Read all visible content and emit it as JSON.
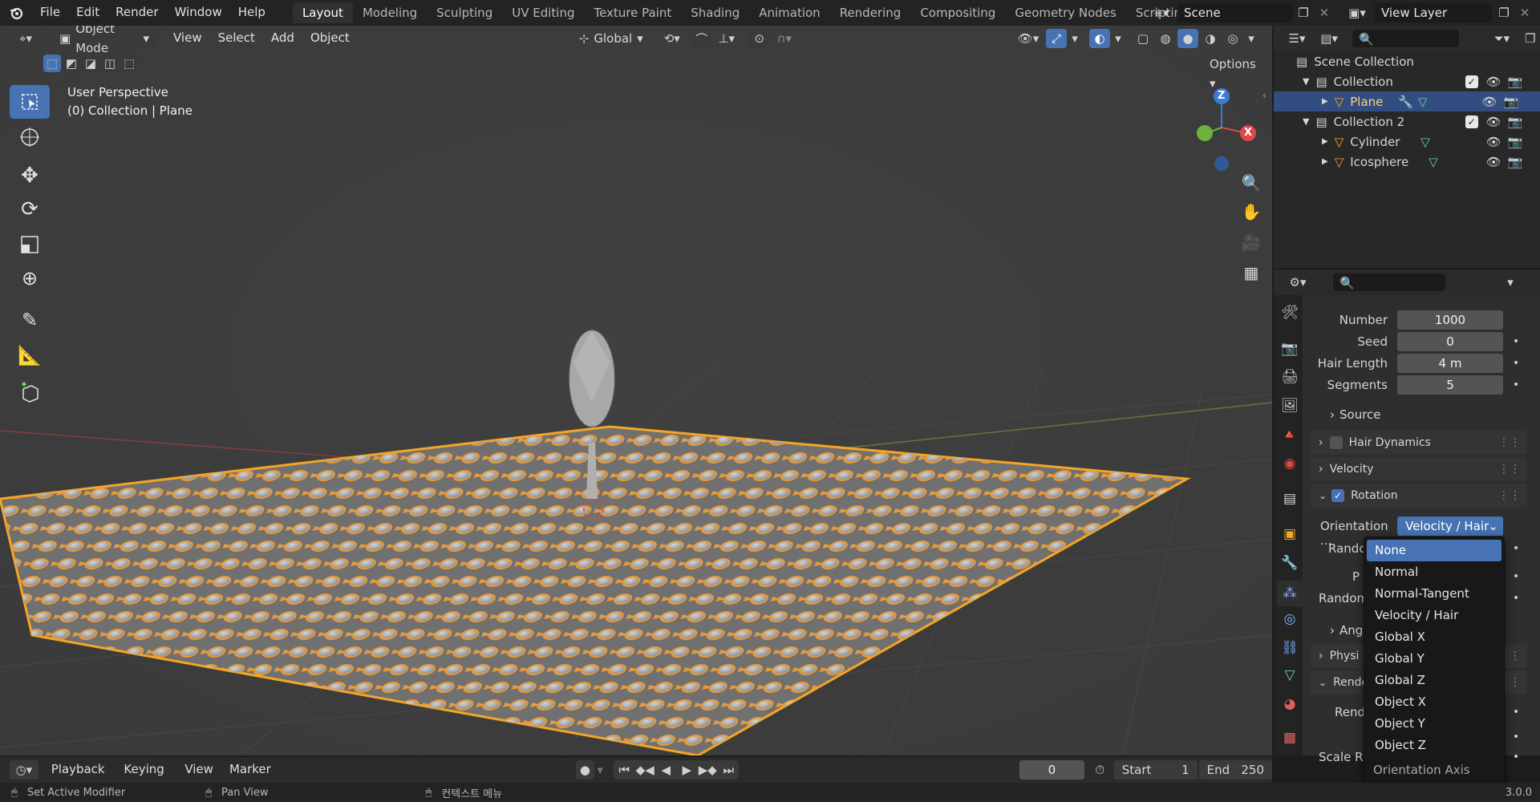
{
  "menu": [
    "File",
    "Edit",
    "Render",
    "Window",
    "Help"
  ],
  "workspaces": [
    "Layout",
    "Modeling",
    "Sculpting",
    "UV Editing",
    "Texture Paint",
    "Shading",
    "Animation",
    "Rendering",
    "Compositing",
    "Geometry Nodes",
    "Scripting"
  ],
  "scene": "Scene",
  "view_layer": "View Layer",
  "viewport_header": {
    "mode": "Object Mode",
    "menus": [
      "View",
      "Select",
      "Add",
      "Object"
    ],
    "transform": "Global",
    "options": "Options"
  },
  "viewport": {
    "perspective": "User Perspective",
    "collection_info": "(0) Collection | Plane",
    "gizmo": {
      "z": "Z",
      "x": "X"
    }
  },
  "outliner": {
    "root": "Scene Collection",
    "items": [
      {
        "name": "Collection"
      },
      {
        "name": "Plane"
      },
      {
        "name": "Collection 2"
      },
      {
        "name": "Cylinder"
      },
      {
        "name": "Icosphere"
      }
    ]
  },
  "properties": {
    "number_label": "Number",
    "number_value": "1000",
    "seed_label": "Seed",
    "seed_value": "0",
    "hair_length_label": "Hair Length",
    "hair_length_value": "4 m",
    "segments_label": "Segments",
    "segments_value": "5",
    "source": "Source",
    "hair_dynamics": "Hair Dynamics",
    "velocity": "Velocity",
    "rotation": "Rotation",
    "orientation_label": "Orientation ...",
    "orientation_value": "Velocity / Hair",
    "rando_partial": "Rando",
    "p_partial": "P",
    "random_partial": "Random",
    "ang_partial": "Ang",
    "physi_partial": "Physi",
    "rende_partial": "Rende",
    "rend_partial": "Rend",
    "s_partial": "S",
    "scale_ra_partial": "Scale Ra"
  },
  "dropdown": {
    "options": [
      "None",
      "Normal",
      "Normal-Tangent",
      "Velocity / Hair",
      "Global X",
      "Global Y",
      "Global Z",
      "Object X",
      "Object Y",
      "Object Z"
    ],
    "selected": "None",
    "footer": "Orientation Axis"
  },
  "timeline": {
    "playback": "Playback",
    "keying": "Keying",
    "view": "View",
    "marker": "Marker",
    "current_frame": "0",
    "start_label": "Start",
    "start_value": "1",
    "end_label": "End",
    "end_value": "250"
  },
  "status": {
    "left": "Set Active Modifier",
    "middle": "Pan View",
    "right": "컨텍스트 메뉴",
    "version": "3.0.0"
  },
  "colors": {
    "accent": "#4772b3",
    "selection": "#f5a623",
    "x_axis": "#e04848",
    "y_axis": "#6bb33a",
    "z_axis": "#3a7bd5"
  }
}
